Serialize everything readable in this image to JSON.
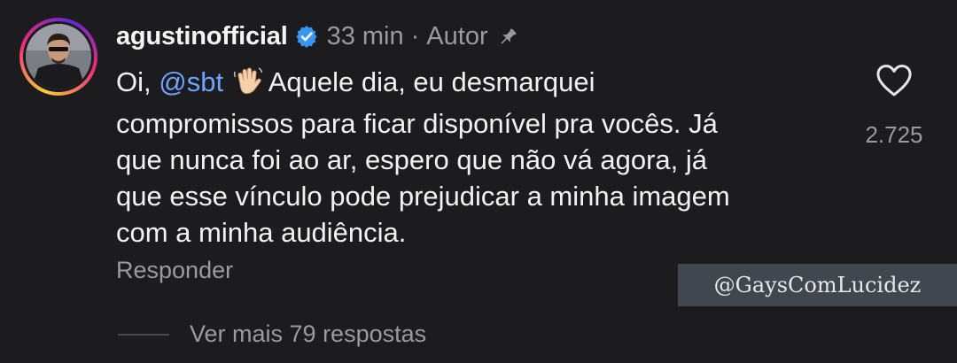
{
  "comment": {
    "username": "agustinofficial",
    "time": "33 min",
    "separator": "·",
    "author_label": "Autor",
    "mention": "@sbt",
    "text_prefix": "Oi, ",
    "text_lines": [
      "Aquele dia, eu desmarquei",
      "compromissos para ficar disponível pra vocês. Já",
      "que nunca foi ao ar, espero que não vá agora, já",
      "que esse vínculo pode prejudicar a minha imagem",
      "com a minha audiência."
    ],
    "like_count": "2.725",
    "reply_label": "Responder",
    "more_replies_label": "Ver mais 79 respostas"
  },
  "watermark": "@GaysComLucidez",
  "icons": {
    "verified": "verified-badge-icon",
    "pin": "pin-icon",
    "like": "heart-icon",
    "emoji": "waving-hand-emoji"
  },
  "colors": {
    "background": "#1c1c1e",
    "text": "#f2f2f2",
    "muted": "#9a9aa0",
    "mention": "#6ea3ff",
    "verified": "#3897f0",
    "watermark_bg": "#40474f"
  }
}
